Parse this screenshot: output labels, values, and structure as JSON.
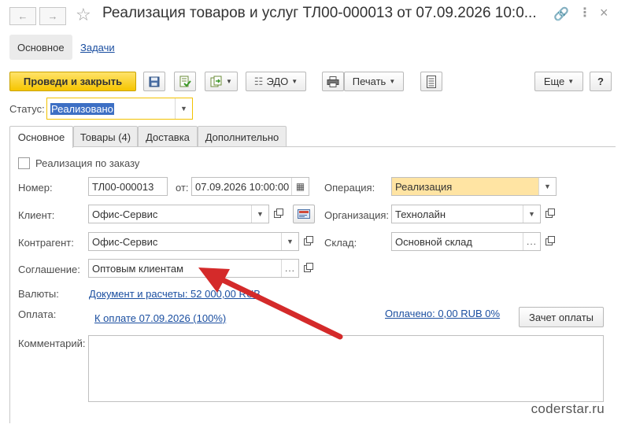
{
  "window": {
    "title": "Реализация товаров и услуг ТЛ00-000013 от 07.09.2026 10:0..."
  },
  "section_tabs": [
    {
      "label": "Основное"
    },
    {
      "label": "Задачи"
    }
  ],
  "toolbar": {
    "post_close_label": "Проведи и закрыть",
    "edo_label": "ЭДО",
    "print_label": "Печать",
    "more_label": "Еще",
    "help_label": "?"
  },
  "status": {
    "label": "Статус:",
    "value": "Реализовано"
  },
  "content_tabs": [
    {
      "label": "Основное"
    },
    {
      "label": "Товары (4)"
    },
    {
      "label": "Доставка"
    },
    {
      "label": "Дополнительно"
    }
  ],
  "form": {
    "by_order_label": "Реализация по заказу",
    "number_label": "Номер:",
    "number_value": "ТЛ00-000013",
    "date_from_label": "от:",
    "date_value": "07.09.2026 10:00:00",
    "operation_label": "Операция:",
    "operation_value": "Реализация",
    "client_label": "Клиент:",
    "client_value": "Офис-Сервис",
    "organization_label": "Организация:",
    "organization_value": "Технолайн",
    "counterparty_label": "Контрагент:",
    "counterparty_value": "Офис-Сервис",
    "warehouse_label": "Склад:",
    "warehouse_value": "Основной склад",
    "agreement_label": "Соглашение:",
    "agreement_value": "Оптовым клиентам",
    "currency_label": "Валюты:",
    "currency_link": "Документ и расчеты: 52 000,00 RUB",
    "payment_label": "Оплата:",
    "payment_link": "К оплате 07.09.2026 (100%)",
    "paid_link": "Оплачено: 0,00 RUB 0%",
    "offset_button": "Зачет оплаты",
    "comment_label": "Комментарий:",
    "comment_value": ""
  },
  "watermark": "coderstar.ru",
  "colors": {
    "primary_button": "#f6c500",
    "link": "#1a4ea0",
    "status_highlight": "#f2c200",
    "operation_bg": "#ffe4a3",
    "annotation_arrow": "#d42a2a"
  }
}
